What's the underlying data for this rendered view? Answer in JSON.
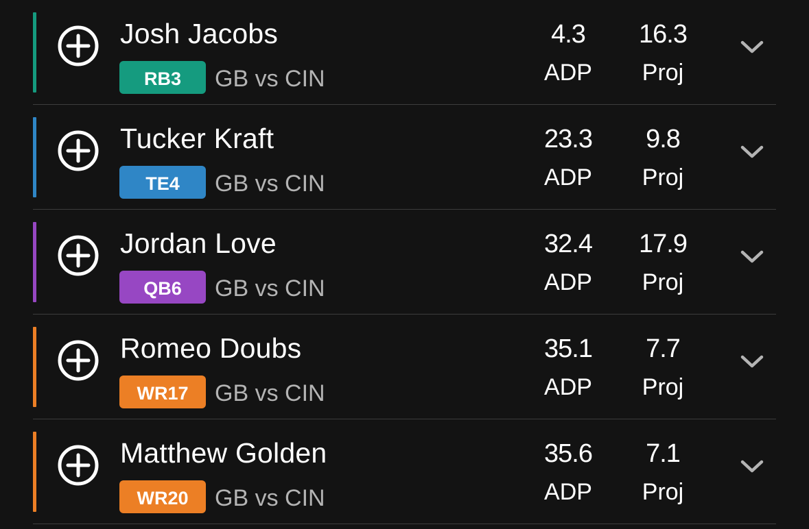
{
  "colors": {
    "background": "#131313",
    "divider": "#3d3d3d",
    "rb": "#159b7f",
    "te": "#2f86c6",
    "qb": "#9747c3",
    "wr": "#ec7f25"
  },
  "stat_labels": {
    "adp": "ADP",
    "proj": "Proj"
  },
  "players": [
    {
      "name": "Josh Jacobs",
      "position": "RB3",
      "matchup": "GB vs CIN",
      "adp": "4.3",
      "proj": "16.3",
      "color": "#159b7f",
      "icon": "plus-circle-icon"
    },
    {
      "name": "Tucker Kraft",
      "position": "TE4",
      "matchup": "GB vs CIN",
      "adp": "23.3",
      "proj": "9.8",
      "color": "#2f86c6",
      "icon": "plus-circle-icon"
    },
    {
      "name": "Jordan Love",
      "position": "QB6",
      "matchup": "GB vs CIN",
      "adp": "32.4",
      "proj": "17.9",
      "color": "#9747c3",
      "icon": "plus-circle-icon"
    },
    {
      "name": "Romeo Doubs",
      "position": "WR17",
      "matchup": "GB vs CIN",
      "adp": "35.1",
      "proj": "7.7",
      "color": "#ec7f25",
      "icon": "plus-circle-icon"
    },
    {
      "name": "Matthew Golden",
      "position": "WR20",
      "matchup": "GB vs CIN",
      "adp": "35.6",
      "proj": "7.1",
      "color": "#ec7f25",
      "icon": "plus-circle-icon"
    }
  ]
}
